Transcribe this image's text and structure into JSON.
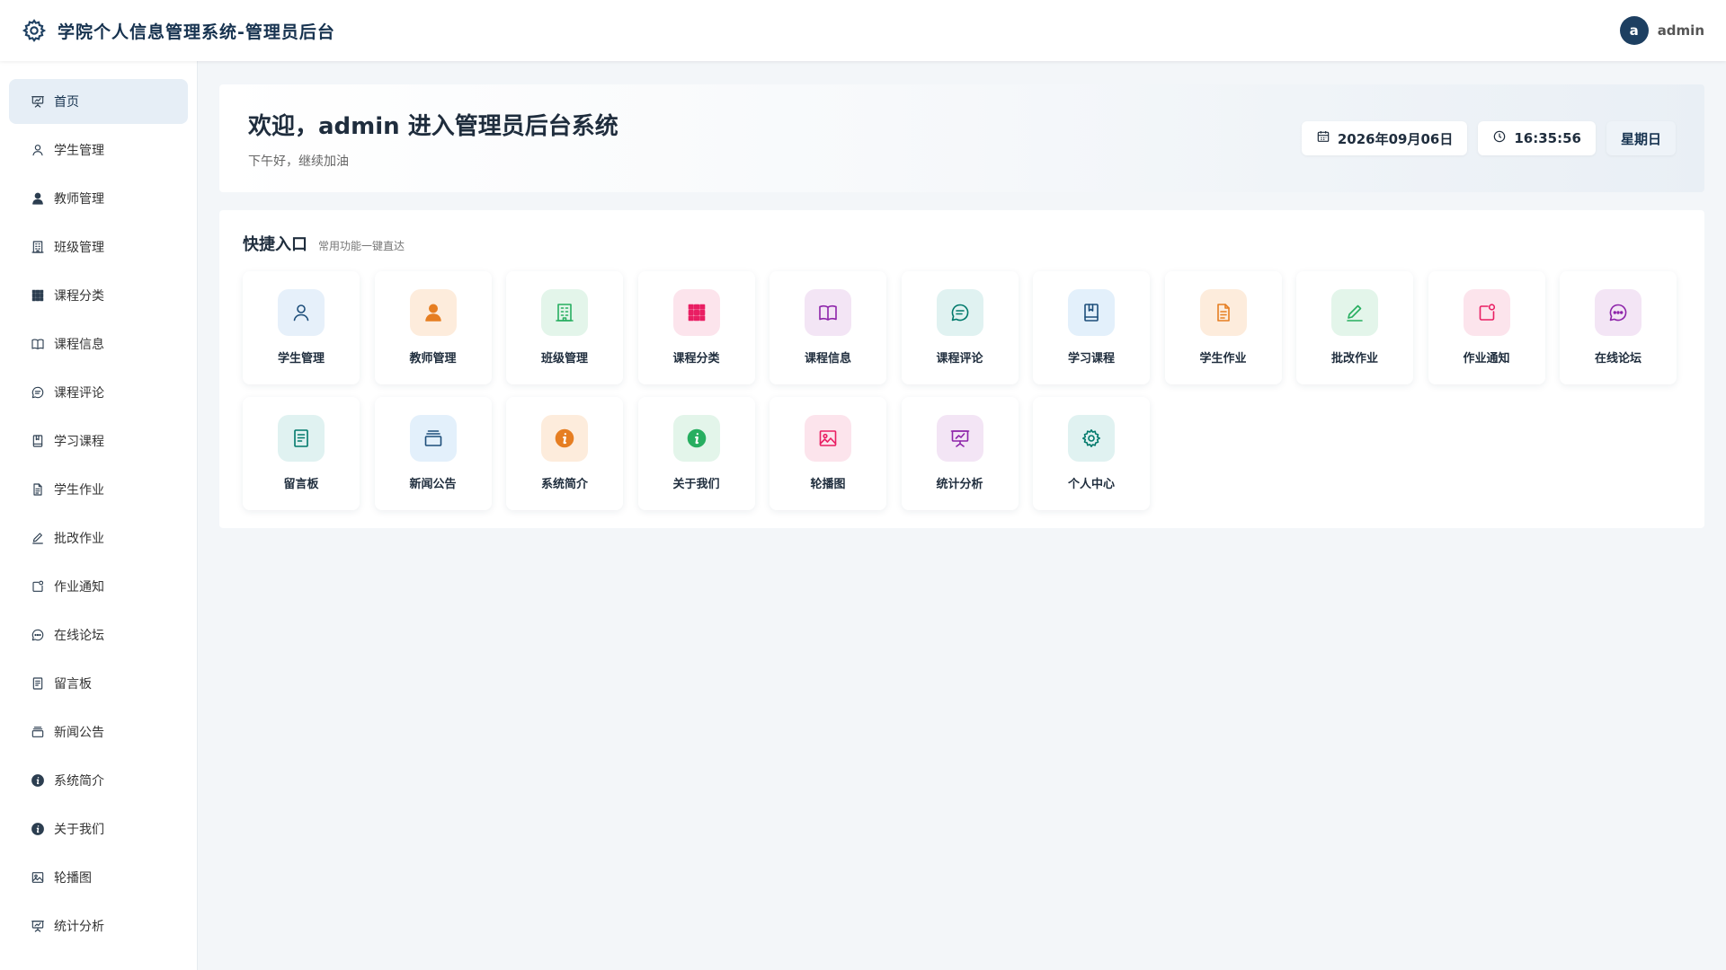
{
  "header": {
    "title": "学院个人信息管理系统-管理员后台",
    "avatar_letter": "a",
    "username": "admin"
  },
  "sidebar": {
    "items": [
      {
        "label": "首页",
        "icon": "presentation-icon"
      },
      {
        "label": "学生管理",
        "icon": "user-icon"
      },
      {
        "label": "教师管理",
        "icon": "user-filled-icon"
      },
      {
        "label": "班级管理",
        "icon": "building-icon"
      },
      {
        "label": "课程分类",
        "icon": "grid-icon"
      },
      {
        "label": "课程信息",
        "icon": "book-icon"
      },
      {
        "label": "课程评论",
        "icon": "chat-icon"
      },
      {
        "label": "学习课程",
        "icon": "notebook-icon"
      },
      {
        "label": "学生作业",
        "icon": "document-icon"
      },
      {
        "label": "批改作业",
        "icon": "edit-pen-icon"
      },
      {
        "label": "作业通知",
        "icon": "notification-icon"
      },
      {
        "label": "在线论坛",
        "icon": "chat-dots-icon"
      },
      {
        "label": "留言板",
        "icon": "memo-icon"
      },
      {
        "label": "新闻公告",
        "icon": "collection-icon"
      },
      {
        "label": "系统简介",
        "icon": "info-filled-icon"
      },
      {
        "label": "关于我们",
        "icon": "info-filled-icon"
      },
      {
        "label": "轮播图",
        "icon": "picture-icon"
      },
      {
        "label": "统计分析",
        "icon": "presentation-icon"
      }
    ]
  },
  "welcome": {
    "title": "欢迎，admin 进入管理员后台系统",
    "subtitle": "下午好，继续加油",
    "date": "2026年09月06日",
    "time": "16:35:56",
    "weekday": "星期日"
  },
  "quick": {
    "title": "快捷入口",
    "subtitle": "常用功能一键直达",
    "tiles": [
      {
        "label": "学生管理",
        "icon": "user-icon",
        "color": "#1d4e7a",
        "bg": "#e6f0fa"
      },
      {
        "label": "教师管理",
        "icon": "user-filled-icon",
        "color": "#e67e22",
        "bg": "#fdecdc"
      },
      {
        "label": "班级管理",
        "icon": "building-icon",
        "color": "#27ae60",
        "bg": "#e3f5ea"
      },
      {
        "label": "课程分类",
        "icon": "grid-icon",
        "color": "#e91e63",
        "bg": "#fce4ec"
      },
      {
        "label": "课程信息",
        "icon": "book-icon",
        "color": "#8e24aa",
        "bg": "#f3e5f5"
      },
      {
        "label": "课程评论",
        "icon": "chat-icon",
        "color": "#00796b",
        "bg": "#e0f2f1"
      },
      {
        "label": "学习课程",
        "icon": "notebook-icon",
        "color": "#1d4e7a",
        "bg": "#e3f0fb"
      },
      {
        "label": "学生作业",
        "icon": "document-icon",
        "color": "#e67e22",
        "bg": "#fdecdc"
      },
      {
        "label": "批改作业",
        "icon": "edit-pen-icon",
        "color": "#27ae60",
        "bg": "#e3f5ea"
      },
      {
        "label": "作业通知",
        "icon": "notification-icon",
        "color": "#e91e63",
        "bg": "#fce4ec"
      },
      {
        "label": "在线论坛",
        "icon": "chat-dots-icon",
        "color": "#8e24aa",
        "bg": "#f3e5f5"
      },
      {
        "label": "留言板",
        "icon": "memo-icon",
        "color": "#00796b",
        "bg": "#e0f2f1"
      },
      {
        "label": "新闻公告",
        "icon": "collection-icon",
        "color": "#1d4e7a",
        "bg": "#e3f0fb"
      },
      {
        "label": "系统简介",
        "icon": "info-filled-icon",
        "color": "#e67e22",
        "bg": "#fdecdc"
      },
      {
        "label": "关于我们",
        "icon": "info-filled-icon",
        "color": "#27ae60",
        "bg": "#e3f5ea"
      },
      {
        "label": "轮播图",
        "icon": "picture-icon",
        "color": "#e91e63",
        "bg": "#fce4ec"
      },
      {
        "label": "统计分析",
        "icon": "presentation-icon",
        "color": "#8e24aa",
        "bg": "#f3e5f5"
      },
      {
        "label": "个人中心",
        "icon": "gear-icon",
        "color": "#00796b",
        "bg": "#e0f2f1"
      }
    ]
  }
}
